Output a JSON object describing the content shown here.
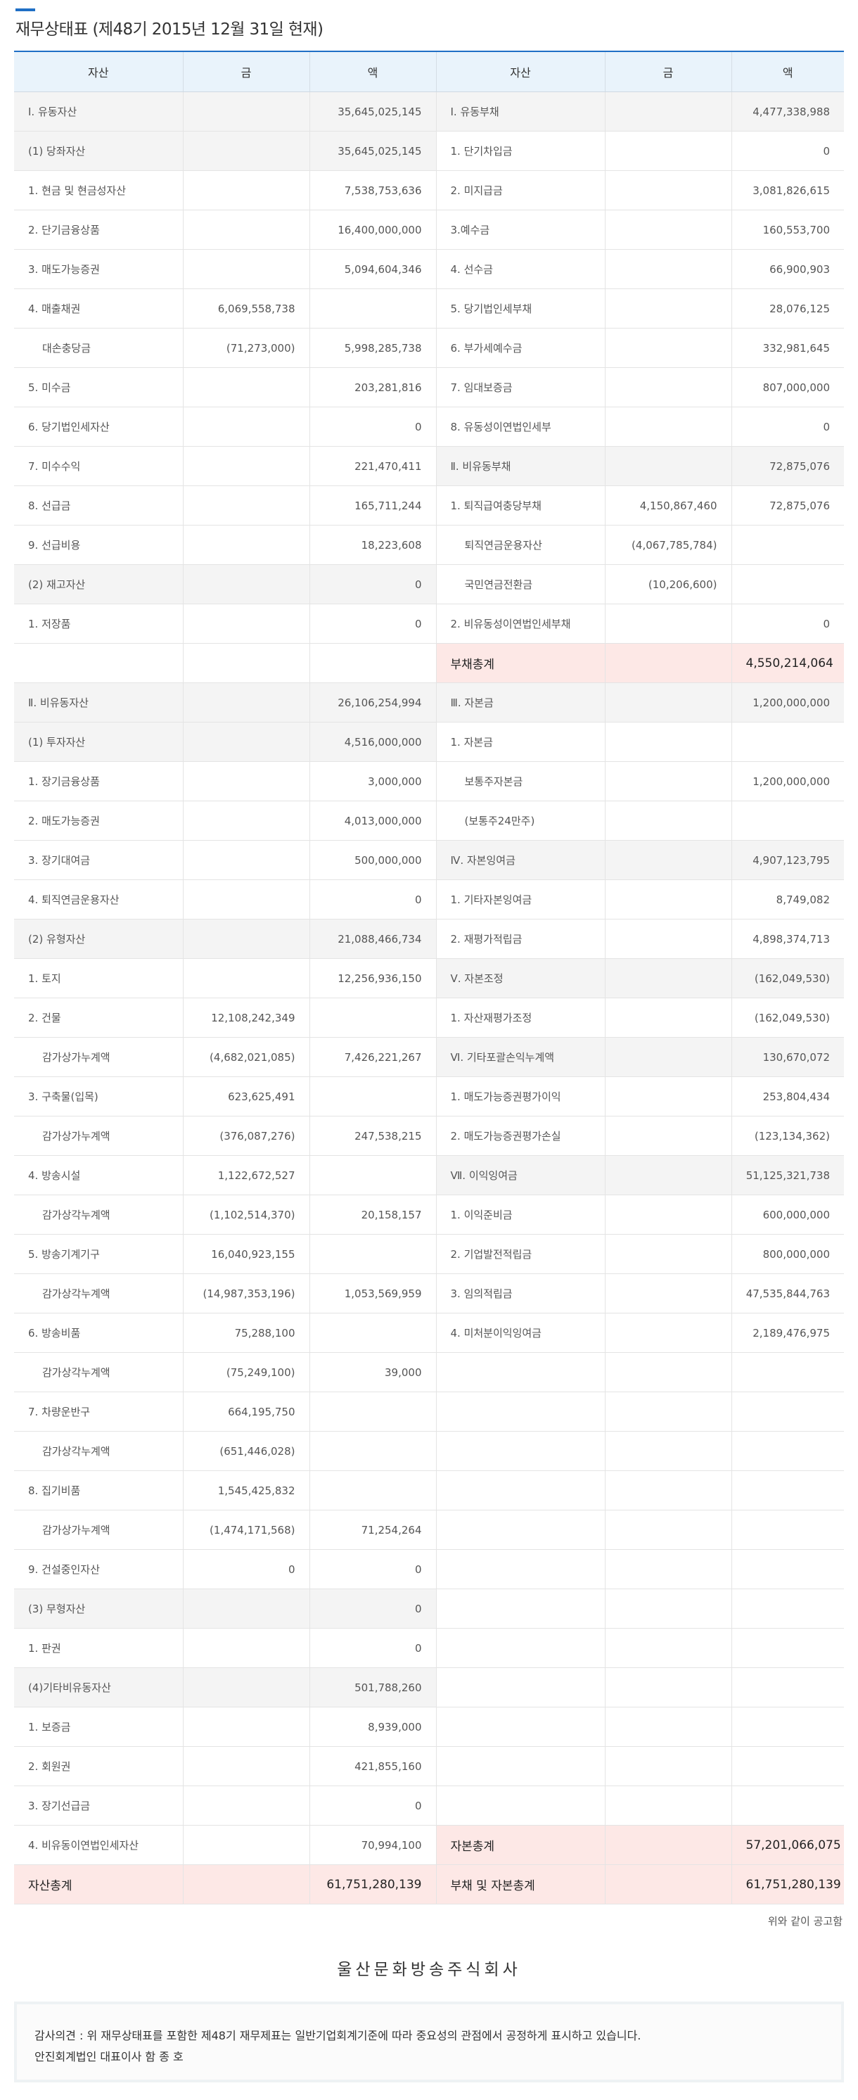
{
  "page": {
    "title": "재무상태표 (제48기 2015년 12월 31일 현재)",
    "announce": "위와 같이 공고함",
    "company": "울산문화방송주식회사",
    "audit_line1": "감사의견 : 위 재무상태표를 포함한 제48기 재무제표는 일반기업회계기준에 따라 중요성의 관점에서 공정하게 표시하고 있습니다.",
    "audit_line2": "안진회계법인 대표이사 함 종 호"
  },
  "header": [
    "자산",
    "금",
    "액",
    "자산",
    "금",
    "액"
  ],
  "rows": [
    [
      "Ⅰ. 유동자산",
      "",
      "35,645,025,145",
      "Ⅰ. 유동부채",
      "",
      "4,477,338,988"
    ],
    [
      "(1) 당좌자산",
      "",
      "35,645,025,145",
      "1. 단기차입금",
      "",
      "0"
    ],
    [
      "1. 현금 및 현금성자산",
      "",
      "7,538,753,636",
      "2. 미지급금",
      "",
      "3,081,826,615"
    ],
    [
      "2. 단기금융상품",
      "",
      "16,400,000,000",
      "3.예수금",
      "",
      "160,553,700"
    ],
    [
      "3. 매도가능증권",
      "",
      "5,094,604,346",
      "4. 선수금",
      "",
      "66,900,903"
    ],
    [
      "4. 매출채권",
      "6,069,558,738",
      "",
      "5. 당기법인세부채",
      "",
      "28,076,125"
    ],
    [
      "대손충당금",
      "(71,273,000)",
      "5,998,285,738",
      "6. 부가세예수금",
      "",
      "332,981,645"
    ],
    [
      "5. 미수금",
      "",
      "203,281,816",
      "7. 임대보증금",
      "",
      "807,000,000"
    ],
    [
      "6. 당기법인세자산",
      "",
      "0",
      "8. 유동성이연법인세부",
      "",
      "0"
    ],
    [
      "7. 미수수익",
      "",
      "221,470,411",
      "Ⅱ. 비유동부채",
      "",
      "72,875,076"
    ],
    [
      "8. 선급금",
      "",
      "165,711,244",
      "1. 퇴직급여충당부채",
      "4,150,867,460",
      "72,875,076"
    ],
    [
      "9. 선급비용",
      "",
      "18,223,608",
      "퇴직연금운용자산",
      "(4,067,785,784)",
      ""
    ],
    [
      "(2) 재고자산",
      "",
      "0",
      "국민연금전환금",
      "(10,206,600)",
      ""
    ],
    [
      "1. 저장품",
      "",
      "0",
      "2. 비유동성이연법인세부채",
      "",
      "0"
    ],
    [
      "",
      "",
      "",
      "부채총계",
      "",
      "4,550,214,064"
    ],
    [
      "Ⅱ. 비유동자산",
      "",
      "26,106,254,994",
      "Ⅲ. 자본금",
      "",
      "1,200,000,000"
    ],
    [
      "(1) 투자자산",
      "",
      "4,516,000,000",
      "1. 자본금",
      "",
      ""
    ],
    [
      "1. 장기금융상품",
      "",
      "3,000,000",
      "보통주자본금",
      "",
      "1,200,000,000"
    ],
    [
      "2. 매도가능증권",
      "",
      "4,013,000,000",
      "(보통주24만주)",
      "",
      ""
    ],
    [
      "3. 장기대여금",
      "",
      "500,000,000",
      "Ⅳ. 자본잉여금",
      "",
      "4,907,123,795"
    ],
    [
      "4. 퇴직연금운용자산",
      "",
      "0",
      "1. 기타자본잉여금",
      "",
      "8,749,082"
    ],
    [
      "(2) 유형자산",
      "",
      "21,088,466,734",
      "2. 재평가적립금",
      "",
      "4,898,374,713"
    ],
    [
      "1. 토지",
      "",
      "12,256,936,150",
      "Ⅴ. 자본조정",
      "",
      "(162,049,530)"
    ],
    [
      "2. 건물",
      "12,108,242,349",
      "",
      "1. 자산재평가조정",
      "",
      "(162,049,530)"
    ],
    [
      "감가상가누계액",
      "(4,682,021,085)",
      "7,426,221,267",
      "Ⅵ. 기타포괄손익누계액",
      "",
      "130,670,072"
    ],
    [
      "3. 구축물(입목)",
      "623,625,491",
      "",
      "1. 매도가능증권평가이익",
      "",
      "253,804,434"
    ],
    [
      "감가상가누계액",
      "(376,087,276)",
      "247,538,215",
      "2. 매도가능증권평가손실",
      "",
      "(123,134,362)"
    ],
    [
      "4. 방송시설",
      "1,122,672,527",
      "",
      "Ⅶ. 이익잉여금",
      "",
      "51,125,321,738"
    ],
    [
      "감가상각누계액",
      "(1,102,514,370)",
      "20,158,157",
      "1. 이익준비금",
      "",
      "600,000,000"
    ],
    [
      "5. 방송기계기구",
      "16,040,923,155",
      "",
      "2. 기업발전적립금",
      "",
      "800,000,000"
    ],
    [
      "감가상각누계액",
      "(14,987,353,196)",
      "1,053,569,959",
      "3. 임의적립금",
      "",
      "47,535,844,763"
    ],
    [
      "6. 방송비품",
      "75,288,100",
      "",
      "4. 미처분이익잉여금",
      "",
      "2,189,476,975"
    ],
    [
      "감가상각누계액",
      "(75,249,100)",
      "39,000",
      "",
      "",
      ""
    ],
    [
      "7. 차량운반구",
      "664,195,750",
      "",
      "",
      "",
      ""
    ],
    [
      "감가상각누계액",
      "(651,446,028)",
      "",
      "",
      "",
      ""
    ],
    [
      "8. 집기비품",
      "1,545,425,832",
      "",
      "",
      "",
      ""
    ],
    [
      "감가상가누계액",
      "(1,474,171,568)",
      "71,254,264",
      "",
      "",
      ""
    ],
    [
      "9. 건설중인자산",
      "0",
      "0",
      "",
      "",
      ""
    ],
    [
      "(3) 무형자산",
      "",
      "0",
      "",
      "",
      ""
    ],
    [
      "1. 판권",
      "",
      "0",
      "",
      "",
      ""
    ],
    [
      "(4)기타비유동자산",
      "",
      "501,788,260",
      "",
      "",
      ""
    ],
    [
      "1. 보증금",
      "",
      "8,939,000",
      "",
      "",
      ""
    ],
    [
      "2. 회원권",
      "",
      "421,855,160",
      "",
      "",
      ""
    ],
    [
      "3. 장기선급금",
      "",
      "0",
      "",
      "",
      ""
    ],
    [
      "4. 비유동이연법인세자산",
      "",
      "70,994,100",
      "자본총계",
      "",
      "57,201,066,075"
    ],
    [
      "자산총계",
      "",
      "61,751,280,139",
      "부채 및 자본총계",
      "",
      "61,751,280,139"
    ]
  ]
}
